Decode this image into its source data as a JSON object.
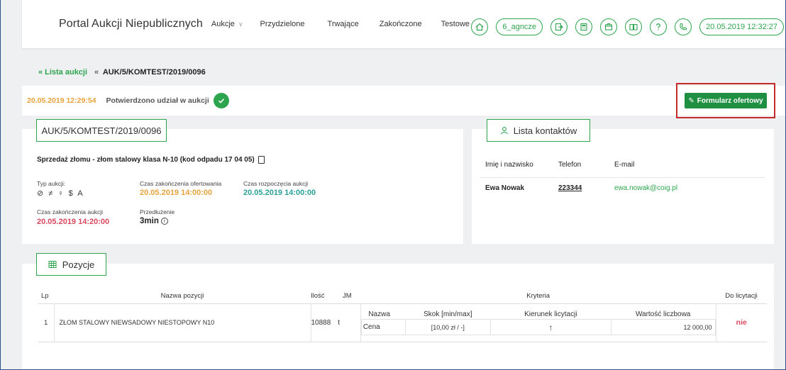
{
  "header": {
    "brand": "Portal Aukcji Niepublicznych",
    "nav": [
      "Aukcje",
      "Przydzielone",
      "Trwające",
      "Zakończone",
      "Testowe"
    ],
    "user": "6_agncze",
    "datetime": "20.05.2019 12:32:27"
  },
  "breadcrumb": {
    "back": "Lista aukcji",
    "current": "AUK/5/KOMTEST/2019/0096"
  },
  "status": {
    "time": "20.05.2019 12:29:54",
    "text": "Potwierdzono udział w aukcji",
    "offer_button": "Formularz ofertowy"
  },
  "auction": {
    "id": "AUK/5/KOMTEST/2019/0096",
    "title": "Sprzedaż złomu - złom stalowy klasa N-10 (kod odpadu 17 04 05)",
    "type_label": "Typ aukcji:",
    "type_icons": "⊘ ≠ ♀ $ A",
    "offer_end_label": "Czas zakończenia ofertowania",
    "offer_end": "20.05.2019 14:00:00",
    "start_label": "Czas rozpoczęcia aukcji",
    "start": "20.05.2019 14:00:00",
    "end_label": "Czas zakończenia aukcji",
    "end": "20.05.2019 14:20:00",
    "extension_label": "Przedłużenie",
    "extension": "3min"
  },
  "contacts": {
    "title": "Lista kontaktów",
    "columns": [
      "Imię i nazwisko",
      "Telefon",
      "E-mail"
    ],
    "rows": [
      {
        "name": "Ewa Nowak",
        "phone": "223344",
        "email": "ewa.nowak@coig.pl"
      }
    ]
  },
  "positions": {
    "title": "Pozycje",
    "columns": {
      "lp": "Lp",
      "name": "Nazwa pozycji",
      "qty": "Ilość",
      "unit": "JM",
      "criteria": "Kryteria",
      "bid": "Do licytacji"
    },
    "criteria_columns": [
      "Nazwa",
      "Skok [min/max]",
      "Kierunek licytacji",
      "Wartość liczbowa"
    ],
    "rows": [
      {
        "lp": "1",
        "name": "ZŁOM STALOWY NIEWSADOWY NIESTOPOWY N10",
        "qty": "10888",
        "unit": "t",
        "criteria": {
          "name": "Cena",
          "step": "[10,00 zł / -]",
          "direction": "↑",
          "value": "12 000,00"
        },
        "bid": "nie"
      }
    ]
  },
  "colors": {
    "accent": "#2da44e",
    "orange": "#e8a33d",
    "teal": "#2aa198",
    "red": "#d9485f",
    "highlight": "#c42b2b"
  }
}
